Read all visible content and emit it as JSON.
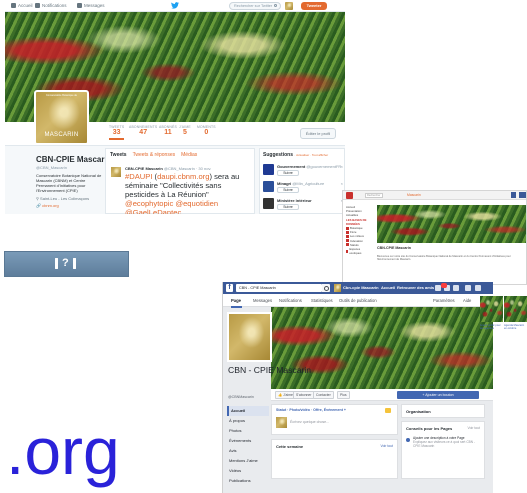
{
  "twitter": {
    "nav": {
      "home": "Accueil",
      "notifications": "Notifications",
      "messages": "Messages"
    },
    "search_placeholder": "Rechercher sur Twitter",
    "tweet_button": "Tweeter",
    "stats": [
      {
        "label": "TWEETS",
        "value": "33"
      },
      {
        "label": "ABONNEMENTS",
        "value": "47"
      },
      {
        "label": "ABONNÉS",
        "value": "11"
      },
      {
        "label": "J'AIME",
        "value": "5"
      },
      {
        "label": "MOMENTS",
        "value": "0"
      }
    ],
    "edit_profile": "Éditer le profil",
    "avatar_small_text": "Conservatoire Botanique de",
    "avatar_brand": "MASCARIN",
    "profile": {
      "name": "CBN-CPIE Mascarin",
      "handle": "@CBN_Mascarin",
      "bio": "Conservatoire Botanique National de Mascarin (CBNM) et Centre Permanent d'Initiatives pour l'Environnement (CPIE)",
      "location": "Saint-Leu - Les Colimaçons",
      "website": "cbnm.org"
    },
    "timeline": {
      "tabs": [
        "Tweets",
        "Tweets & réponses",
        "Médias"
      ],
      "tweet_author": "CBN-CPIE Mascarin",
      "tweet_meta": "@CBN_Mascarin · 30 nov.",
      "tweet_text": [
        {
          "t": "#DAUPI",
          "hl": true
        },
        {
          "t": " (",
          "hl": false
        },
        {
          "t": "daupi.cbnm.org",
          "hl": true
        },
        {
          "t": ") sera au séminaire \"Collectivités sans pesticides à La Réunion\" ",
          "hl": false
        },
        {
          "t": "@ecophytopic",
          "hl": true
        },
        {
          "t": " ",
          "hl": false
        },
        {
          "t": "@equotidien",
          "hl": true
        },
        {
          "t": " ",
          "hl": false
        },
        {
          "t": "@GaelLeDantec",
          "hl": true
        }
      ]
    },
    "suggestions": {
      "title": "Suggestions",
      "sub": "· Actualiser · Tout afficher",
      "items": [
        {
          "name": "Gouvernement",
          "handle": "@gouvernementFR",
          "follow": "Suivre",
          "color": "#1f3a93"
        },
        {
          "name": "Minagri",
          "handle": "@Min_Agriculture",
          "follow": "Suivre",
          "color": "#2b4f9a"
        },
        {
          "name": "Ministère Intérieur",
          "handle": "",
          "follow": "Suivre",
          "color": "#333333"
        }
      ]
    }
  },
  "web_thumb": {
    "search": "Rechercher",
    "header_title": "Mascarin",
    "side_items": [
      "Accueil",
      "Présentation",
      "Actualités"
    ],
    "side_heading": "LES BASES DE DONNÉES",
    "side_links": [
      "Botanique",
      "Flore",
      "Les milieux",
      "Indexation",
      "Statuts",
      "Espèces exotiques"
    ],
    "title": "CBN-CPIE Mascarin",
    "desc": "Bienvenue sur notre site du Conservatoire Botanique National de Mascarin et du Centre Permanent d'Initiatives pour l'Environnement de Mascarin."
  },
  "facebook": {
    "search_value": "CBN - CPIE Mascarin",
    "nav": [
      "Cbn-cpie Mascarin",
      "Accueil",
      "Retrouver des amis"
    ],
    "tabs": [
      "Page",
      "Messages",
      "Notifications",
      "Statistiques",
      "Outils de publication"
    ],
    "tabs_right": [
      "Paramètres",
      "Aide"
    ],
    "page_name": "CBN - CPIE Mascarin",
    "page_handle": "@CBNMascarin",
    "left_nav": [
      "Accueil",
      "À propos",
      "Photos",
      "Événements",
      "Avis",
      "Mentions J'aime",
      "Vidéos",
      "Publications"
    ],
    "actions": [
      "J'aime",
      "S'abonner",
      "Contacter",
      "Plus"
    ],
    "add_button": "+ Ajouter un bouton",
    "composer_tabs": "Statut · Photo/vidéo · Offre, Événement +",
    "composer_placeholder": "Écrivez quelque chose...",
    "week_title": "Cette semaine",
    "week_link": "Voir tout",
    "org_box": "Organisation",
    "tips_title": "Conseils pour les Pages",
    "tips_link": "Voir tout",
    "tip_text": "Ajouter une description à votre Page",
    "tip_sub": "Expliquez aux visiteurs ce à quoi sert CBN - CPIE Mascarin",
    "right_col": [
      "Créer une Page"
    ]
  },
  "right_thumbs": [
    {
      "caption": "Grand public pour les agendas",
      "color": "#7c5a3a"
    },
    {
      "caption": "Agenda Mascarin en octobre",
      "color": "#5a4a3a"
    }
  ],
  "org_text": ".org",
  "colors": {
    "twitter_accent": "#e36a2f",
    "facebook_blue": "#3b5998",
    "org_blue": "#2a22d9",
    "pill_blue": "#6b8cab"
  },
  "icons": {
    "twitter_nav": [
      "home-icon",
      "bell-icon",
      "mail-icon"
    ],
    "pill": [
      "bar-icon",
      "question-icon",
      "bar-icon"
    ]
  }
}
